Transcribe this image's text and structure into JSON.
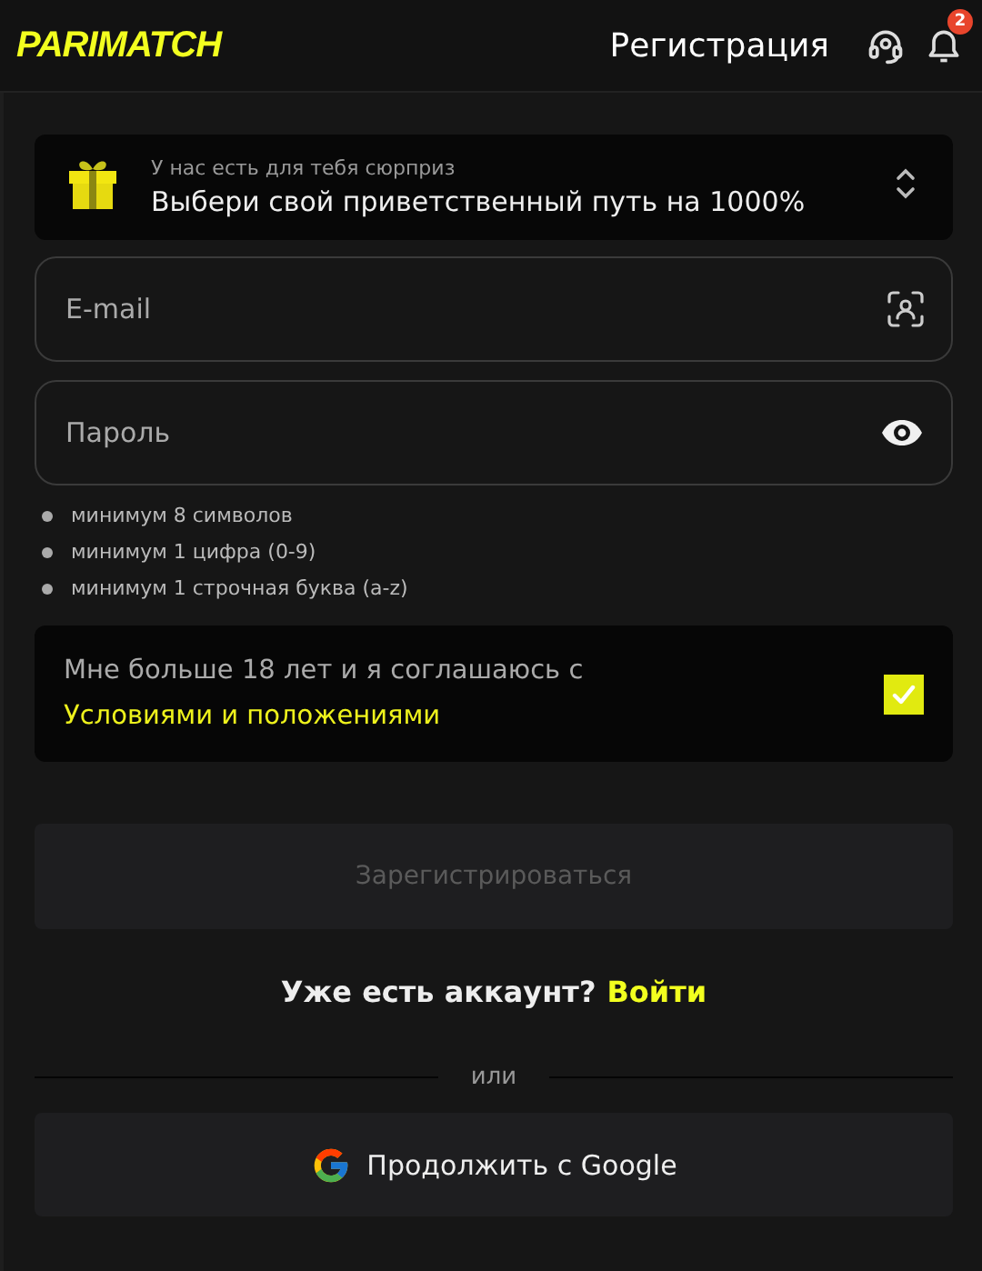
{
  "header": {
    "logo": "PARIMATCH",
    "title": "Регистрация",
    "notification_count": "2"
  },
  "promo": {
    "caption": "У нас есть для тебя сюрприз",
    "title": "Выбери свой приветственный путь на 1000%"
  },
  "fields": [
    {
      "kind": "email",
      "placeholder": "E-mail"
    },
    {
      "kind": "password",
      "placeholder": "Пароль"
    }
  ],
  "password_rules": [
    "минимум 8 символов",
    "минимум 1 цифра (0-9)",
    "минимум 1 строчная буква (a-z)"
  ],
  "consent": {
    "text": "Мне больше 18 лет и я соглашаюсь с",
    "link": "Условиями и положениями",
    "checked": true
  },
  "register_button": {
    "label": "Зарегистрироваться",
    "disabled": true
  },
  "login": {
    "prompt": "Уже есть аккаунт?",
    "link": "Войти"
  },
  "divider": "или",
  "google_button": "Продолжить с Google"
}
